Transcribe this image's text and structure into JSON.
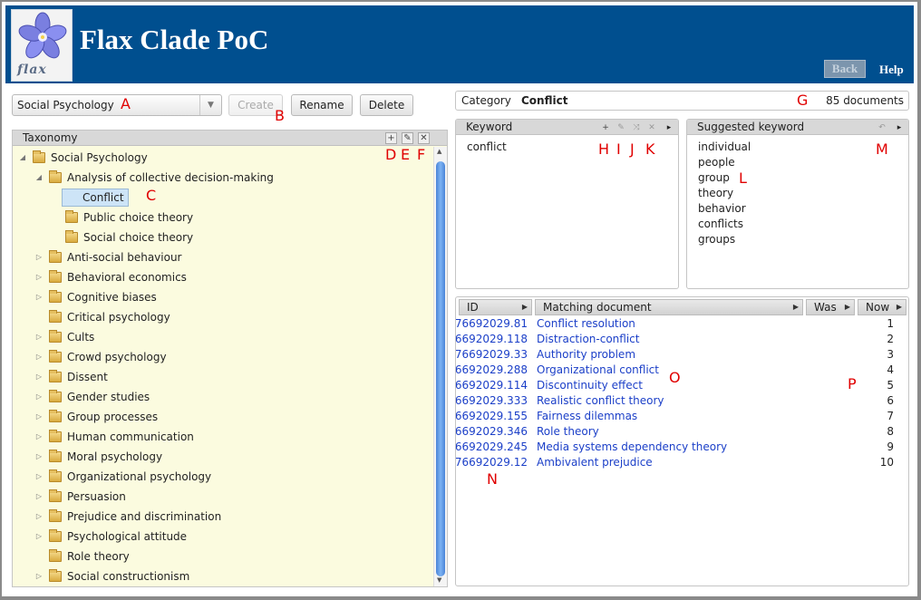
{
  "app": {
    "title": "Flax Clade PoC",
    "logo_text": "flax",
    "back_label": "Back",
    "help_label": "Help"
  },
  "toolbar": {
    "taxonomy_selected": "Social Psychology",
    "create_label": "Create",
    "rename_label": "Rename",
    "delete_label": "Delete"
  },
  "taxonomy": {
    "title": "Taxonomy",
    "tools": {
      "add": "+",
      "edit": "✎",
      "delete": "✕"
    },
    "nodes": [
      {
        "label": "Social Psychology",
        "level": 0,
        "expanded": true
      },
      {
        "label": "Analysis of collective decision-making",
        "level": 1,
        "expanded": true
      },
      {
        "label": "Conflict",
        "level": 2,
        "selected": true
      },
      {
        "label": "Public choice theory",
        "level": 2
      },
      {
        "label": "Social choice theory",
        "level": 2
      },
      {
        "label": "Anti-social behaviour",
        "level": 1,
        "collapsed": true
      },
      {
        "label": "Behavioral economics",
        "level": 1,
        "collapsed": true
      },
      {
        "label": "Cognitive biases",
        "level": 1,
        "collapsed": true
      },
      {
        "label": "Critical psychology",
        "level": 1
      },
      {
        "label": "Cults",
        "level": 1,
        "collapsed": true
      },
      {
        "label": "Crowd psychology",
        "level": 1,
        "collapsed": true
      },
      {
        "label": "Dissent",
        "level": 1,
        "collapsed": true
      },
      {
        "label": "Gender studies",
        "level": 1,
        "collapsed": true
      },
      {
        "label": "Group processes",
        "level": 1,
        "collapsed": true
      },
      {
        "label": "Human communication",
        "level": 1,
        "collapsed": true
      },
      {
        "label": "Moral psychology",
        "level": 1,
        "collapsed": true
      },
      {
        "label": "Organizational psychology",
        "level": 1,
        "collapsed": true
      },
      {
        "label": "Persuasion",
        "level": 1,
        "collapsed": true
      },
      {
        "label": "Prejudice and discrimination",
        "level": 1,
        "collapsed": true
      },
      {
        "label": "Psychological attitude",
        "level": 1,
        "collapsed": true
      },
      {
        "label": "Role theory",
        "level": 1
      },
      {
        "label": "Social constructionism",
        "level": 1,
        "collapsed": true
      }
    ]
  },
  "category": {
    "label": "Category",
    "name": "Conflict",
    "documents": "85 documents"
  },
  "keyword_panel": {
    "title": "Keyword",
    "tools": {
      "add": "+",
      "edit": "✎",
      "merge": "⤨",
      "delete": "✕",
      "more": "▸"
    },
    "items": [
      "conflict"
    ]
  },
  "suggested_panel": {
    "title": "Suggested keyword",
    "tools": {
      "undo": "↶",
      "more": "▸"
    },
    "items": [
      "individual",
      "people",
      "group",
      "theory",
      "behavior",
      "conflicts",
      "groups"
    ]
  },
  "results": {
    "columns": {
      "id": "ID",
      "doc": "Matching document",
      "was": "Was",
      "now": "Now"
    },
    "rows": [
      {
        "id": "76692029.81",
        "doc": "Conflict resolution",
        "now": "1"
      },
      {
        "id": "76692029.118",
        "doc": "Distraction-conflict",
        "now": "2"
      },
      {
        "id": "76692029.33",
        "doc": "Authority problem",
        "now": "3"
      },
      {
        "id": "76692029.288",
        "doc": "Organizational conflict",
        "now": "4"
      },
      {
        "id": "76692029.114",
        "doc": "Discontinuity effect",
        "now": "5"
      },
      {
        "id": "76692029.333",
        "doc": "Realistic conflict theory",
        "now": "6"
      },
      {
        "id": "76692029.155",
        "doc": "Fairness dilemmas",
        "now": "7"
      },
      {
        "id": "76692029.346",
        "doc": "Role theory",
        "now": "8"
      },
      {
        "id": "76692029.245",
        "doc": "Media systems dependency theory",
        "now": "9"
      },
      {
        "id": "76692029.12",
        "doc": "Ambivalent prejudice",
        "now": "10"
      }
    ]
  },
  "annotations": {
    "A": "A",
    "B": "B",
    "C": "C",
    "D": "D",
    "E": "E",
    "F": "F",
    "G": "G",
    "H": "H",
    "I": "I",
    "J": "J",
    "K": "K",
    "L": "L",
    "M": "M",
    "N": "N",
    "O": "O",
    "P": "P"
  },
  "colors": {
    "header": "#004f8f",
    "tree_bg": "#fbfbdf",
    "link": "#1b3fc8",
    "annotation": "#e00000"
  }
}
